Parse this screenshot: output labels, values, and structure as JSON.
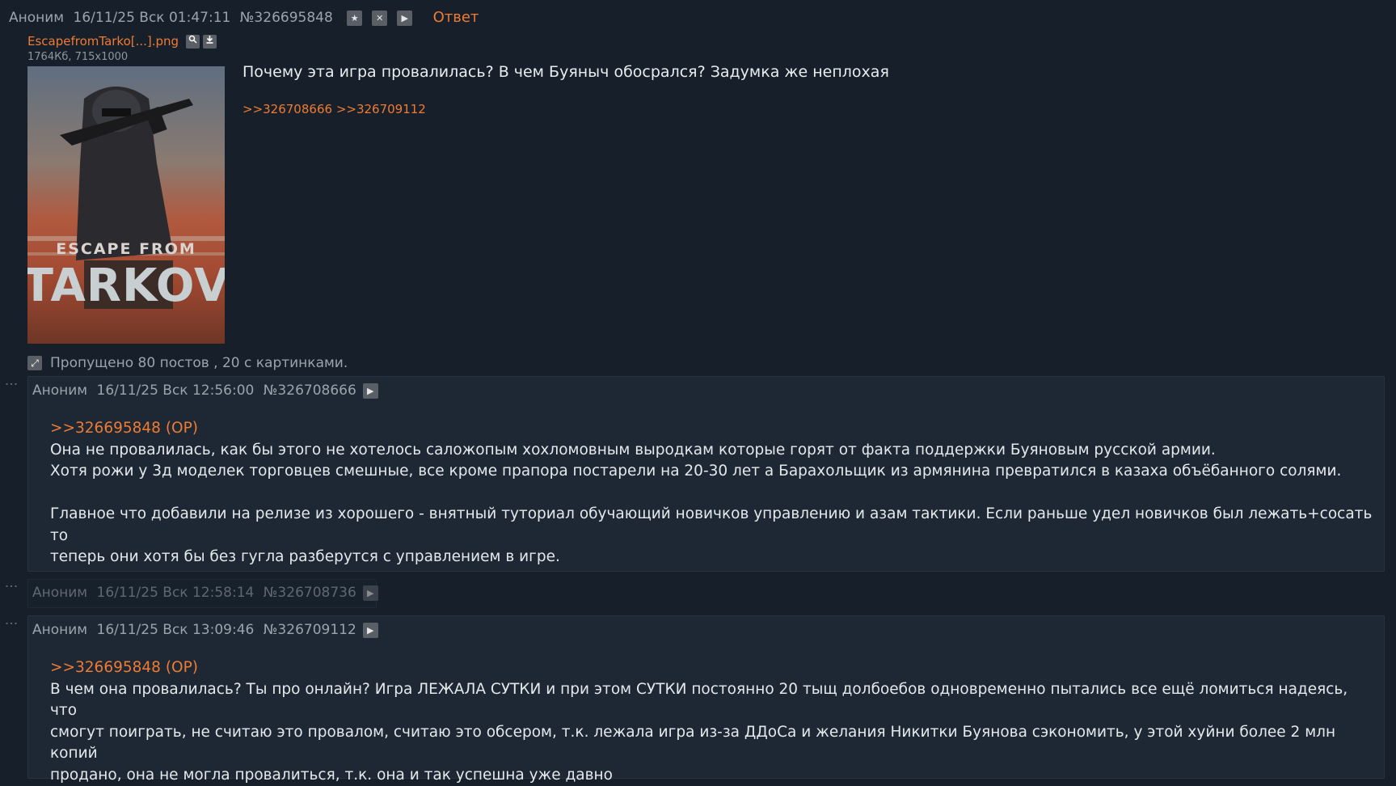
{
  "op": {
    "name": "Аноним",
    "date": "16/11/25 Вск 01:47:11",
    "num": "№326695848",
    "star_icon": "★",
    "hide_icon": "✕",
    "play_icon": "▶",
    "reply": "Ответ",
    "file": {
      "name": "EscapefromTarko[...].png",
      "meta": "1764Кб, 715x1000",
      "image_text_top": "ESCAPE FROM",
      "image_text_bottom": "TARKOV"
    },
    "text": "Почему эта игра провалилась? В чем Буяныч обосрался? Задумка же неплохая",
    "backlinks": [
      ">>326708666",
      ">>326709112"
    ]
  },
  "omitted": "Пропущено 80 постов , 20 с картинками.",
  "posts": [
    {
      "name": "Аноним",
      "date": "16/11/25 Вск 12:56:00",
      "num": "№326708666",
      "quote": ">>326695848 (OP)",
      "lines": [
        "Она не провалилась, как бы этого не хотелось саложопым хохломовным выродкам которые горят от факта поддержки Буяновым русской армии.",
        "Хотя рожи у 3д моделек торговцев смешные, все кроме прапора постарели на 20-30 лет а Барахольщик из армянина превратился в казаха объёбанного солями.",
        "Главное что добавили на релизе из хорошего - внятный туториал обучающий новичков управлению и азам тактики. Если раньше удел новичков был лежать+сосать то",
        "теперь они хотя бы без гугла разберутся с управлением в игре."
      ]
    },
    {
      "name": "Аноним",
      "date": "16/11/25 Вск 12:58:14",
      "num": "№326708736"
    },
    {
      "name": "Аноним",
      "date": "16/11/25 Вск 13:09:46",
      "num": "№326709112",
      "quote": ">>326695848 (OP)",
      "lines": [
        "В чем она провалилась? Ты про онлайн? Игра ЛЕЖАЛА СУТКИ и при этом СУТКИ постоянно 20 тыщ долбоебов одновременно пытались все ещё ломиться надеясь, что",
        "смогут поиграть, не считаю это провалом, считаю это обсером, т.к. лежала игра из-за ДДоСа и желания Никитки Буянова сэкономить, у этой хуйни более 2 млн копий",
        "продано, она не могла провалиться, т.к. она и так успешна уже давно"
      ]
    }
  ],
  "dots": "⋮"
}
